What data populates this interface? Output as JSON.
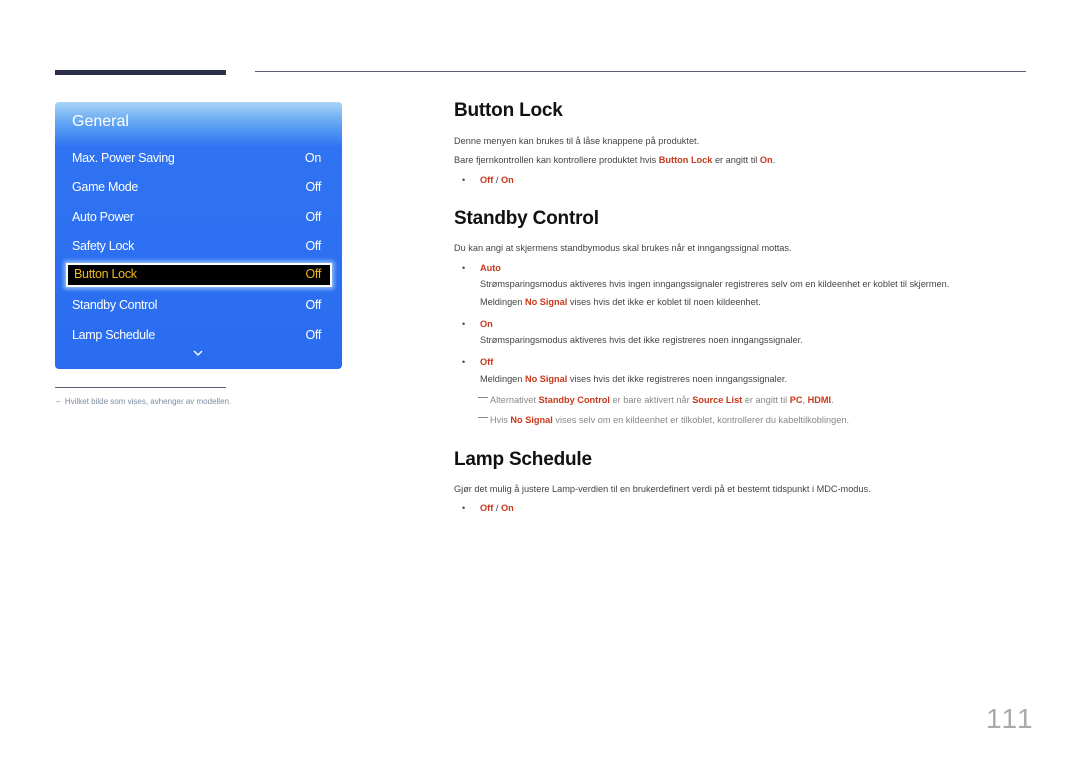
{
  "menu": {
    "title": "General",
    "items": [
      {
        "label": "Max. Power Saving",
        "value": "On"
      },
      {
        "label": "Game Mode",
        "value": "Off"
      },
      {
        "label": "Auto Power",
        "value": "Off"
      },
      {
        "label": "Safety Lock",
        "value": "Off"
      },
      {
        "label": "Button Lock",
        "value": "Off",
        "selected": true
      },
      {
        "label": "Standby Control",
        "value": "Off"
      },
      {
        "label": "Lamp Schedule",
        "value": "Off"
      }
    ],
    "more_icon": "chevron-down-icon"
  },
  "footnote": "Hvilket bilde som vises, avhenger av modellen.",
  "footnote_dash": "–",
  "sections": {
    "button_lock": {
      "title": "Button Lock",
      "p1": "Denne menyen kan brukes til å låse knappene på produktet.",
      "p2_a": "Bare fjernkontrollen kan kontrollere produktet hvis ",
      "p2_b": "Button Lock",
      "p2_c": " er angitt til ",
      "p2_d": "On",
      "p2_e": ".",
      "opt_off": "Off",
      "opt_sep": " / ",
      "opt_on": "On"
    },
    "standby_control": {
      "title": "Standby Control",
      "p1": "Du kan angi at skjermens standbymodus skal brukes når et inngangssignal mottas.",
      "auto_label": "Auto",
      "auto_desc1": "Strømsparingsmodus aktiveres hvis ingen inngangssignaler registreres selv om en kildeenhet er koblet til skjermen.",
      "auto_desc2_a": "Meldingen ",
      "auto_desc2_b": "No Signal",
      "auto_desc2_c": " vises hvis det ikke er koblet til noen kildeenhet.",
      "on_label": "On",
      "on_desc": "Strømsparingsmodus aktiveres hvis det ikke registreres noen inngangssignaler.",
      "off_label": "Off",
      "off_desc_a": "Meldingen ",
      "off_desc_b": "No Signal",
      "off_desc_c": " vises hvis det ikke registreres noen inngangssignaler.",
      "note1_a": "Alternativet ",
      "note1_b": "Standby Control",
      "note1_c": " er bare aktivert når ",
      "note1_d": "Source List",
      "note1_e": " er angitt til ",
      "note1_f": "PC",
      "note1_g": ", ",
      "note1_h": "HDMI",
      "note1_i": ".",
      "note2_a": "Hvis ",
      "note2_b": "No Signal",
      "note2_c": " vises selv om en kildeenhet er tilkoblet, kontrollerer du kabeltilkoblingen."
    },
    "lamp_schedule": {
      "title": "Lamp Schedule",
      "p1": "Gjør det mulig å justere Lamp-verdien til en brukerdefinert verdi på et bestemt tidspunkt i MDC-modus.",
      "opt_off": "Off",
      "opt_sep": " / ",
      "opt_on": "On"
    }
  },
  "bullet": "•",
  "page_number": "111"
}
